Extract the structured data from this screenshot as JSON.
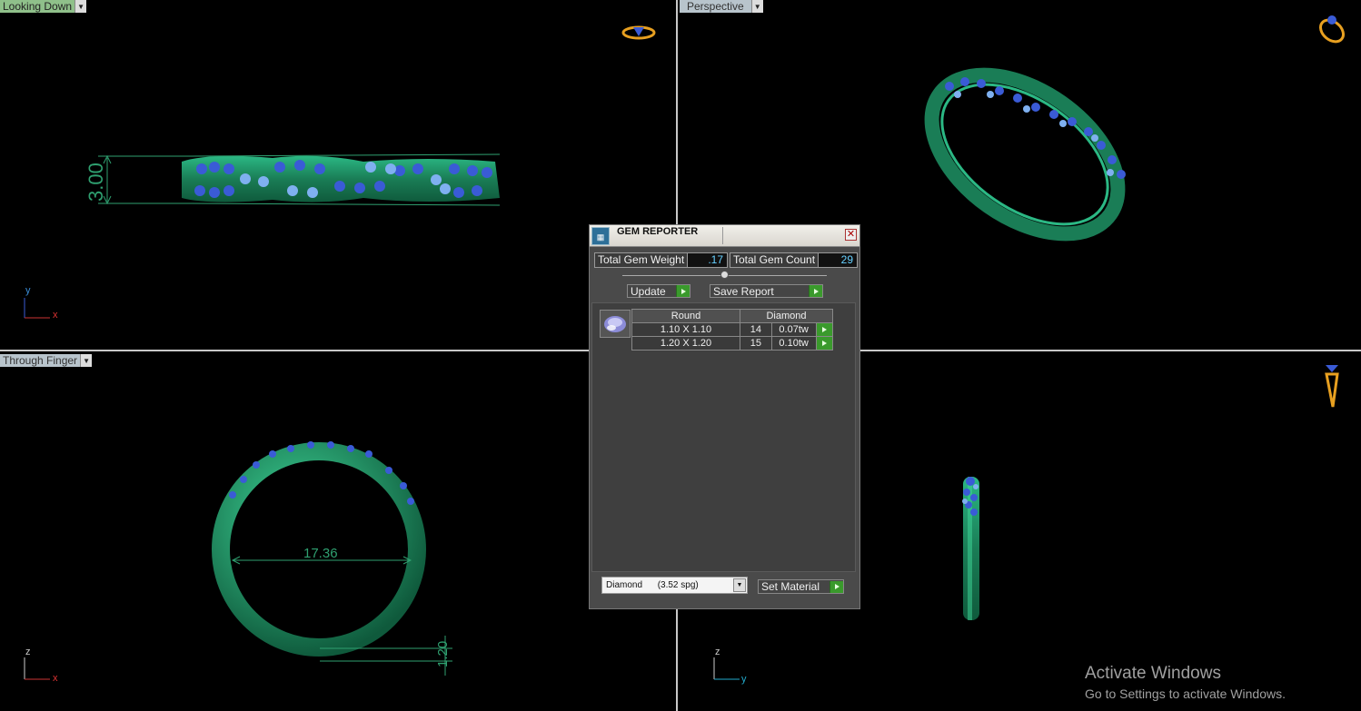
{
  "viewports": {
    "top_left": {
      "label": "Looking Down",
      "dimension": "3.00",
      "axis_v": "y",
      "axis_h": "x"
    },
    "top_right": {
      "label": "Perspective"
    },
    "bottom_left": {
      "label": "Through Finger",
      "diameter": "17.36",
      "thickness": "1.20",
      "axis_v": "z",
      "axis_h": "x"
    },
    "bottom_right": {
      "axis_v": "z",
      "axis_h": "y"
    }
  },
  "gem_reporter": {
    "title": "GEM REPORTER",
    "total_weight_label": "Total Gem Weight",
    "total_weight_value": ".17",
    "total_count_label": "Total Gem Count",
    "total_count_value": "29",
    "update_label": "Update",
    "save_report_label": "Save Report",
    "table": {
      "shape": "Round",
      "material": "Diamond",
      "rows": [
        {
          "size": "1.10 X 1.10",
          "count": "14",
          "weight": "0.07tw"
        },
        {
          "size": "1.20 X 1.20",
          "count": "15",
          "weight": "0.10tw"
        }
      ]
    },
    "material_select": "Diamond      (3.52 spg)",
    "set_material_label": "Set Material"
  },
  "watermark": {
    "line1": "Activate Windows",
    "line2": "Go to Settings to activate Windows."
  },
  "colors": {
    "ring_green": "#1d8a5e",
    "gem_blue": "#3a5bd6",
    "gem_light": "#7fb0f0",
    "dimension_green": "#2fa070"
  }
}
